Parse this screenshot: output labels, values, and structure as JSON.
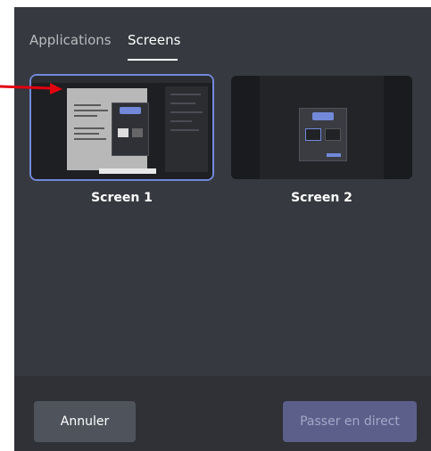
{
  "tabs": [
    {
      "label": "Applications",
      "active": false
    },
    {
      "label": "Screens",
      "active": true
    }
  ],
  "sources": [
    {
      "label": "Screen 1",
      "selected": true
    },
    {
      "label": "Screen 2",
      "selected": false
    }
  ],
  "footer": {
    "cancel_label": "Annuler",
    "go_live_label": "Passer en direct",
    "go_live_enabled": false
  },
  "colors": {
    "modal_bg": "#36393f",
    "footer_bg": "#2f3136",
    "selection_border": "#7289da",
    "cancel_button": "#4f545c",
    "go_live_button_disabled": "#5b5f8a",
    "annotation_arrow": "#e3000f"
  },
  "annotation": {
    "type": "arrow-icon",
    "color": "#e3000f"
  }
}
